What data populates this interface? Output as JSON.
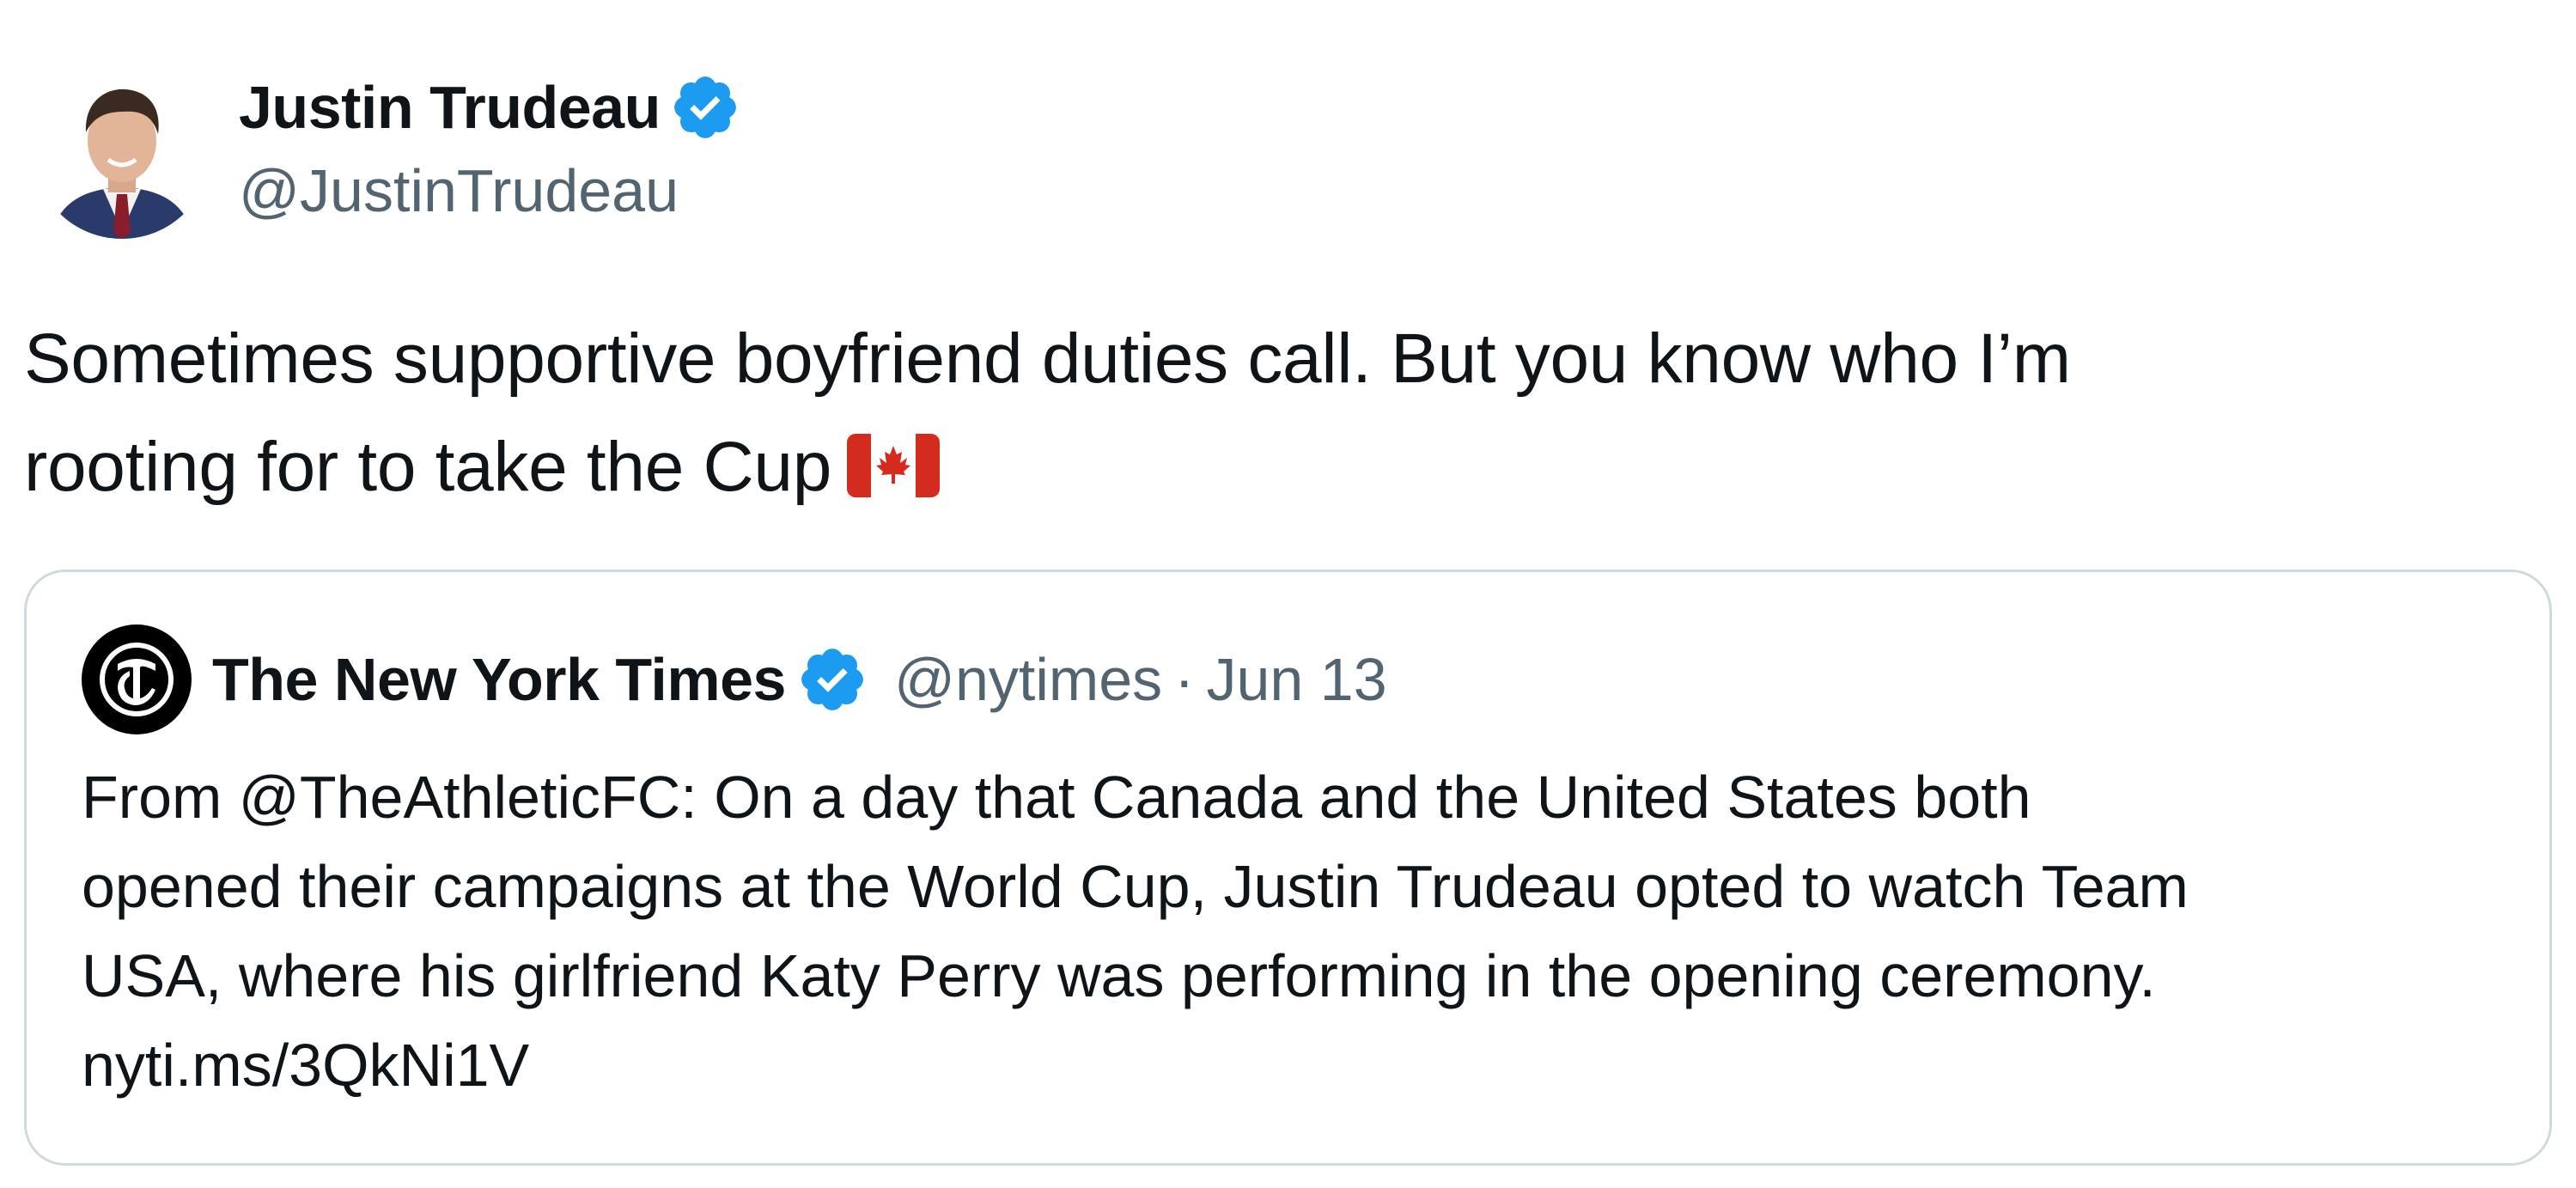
{
  "tweet": {
    "author_name": "Justin Trudeau",
    "author_handle": "@JustinTrudeau",
    "text_line1": "Sometimes supportive boyfriend duties call. But you know who I’m",
    "text_line2": "rooting for to take the Cup",
    "emoji": "canadian-flag"
  },
  "quote": {
    "author_name": "The New York Times",
    "author_handle": "@nytimes",
    "separator": "·",
    "date": "Jun 13",
    "lines": [
      "From @TheAthleticFC: On a day that Canada and the United States both",
      "opened their campaigns at the World Cup, Justin Trudeau opted to watch Team",
      "USA, where his girlfriend Katy Perry was performing in the opening ceremony.",
      "nyti.ms/3QkNi1V"
    ]
  },
  "colors": {
    "verified": "#1d9bf0",
    "secondary_text": "#536471",
    "border": "#cfd9de",
    "flag_red": "#d52b1e"
  }
}
